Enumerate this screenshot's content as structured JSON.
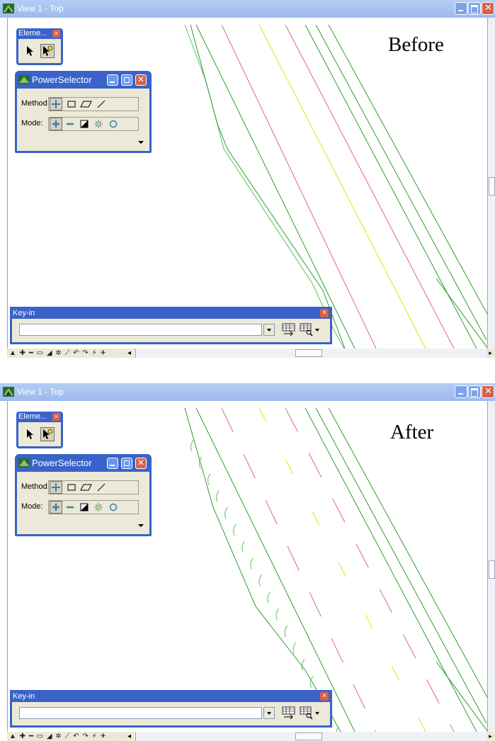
{
  "panels": [
    {
      "annotation": "Before",
      "window": {
        "title": "View 1 - Top"
      },
      "element_toolbox": {
        "title": "Eleme..."
      },
      "power_selector": {
        "title": "PowerSelector",
        "method_label": "Method:",
        "mode_label": "Mode:"
      },
      "keyin": {
        "title": "Key-in",
        "value": ""
      },
      "road_lines": {
        "green": "#2e9e2e",
        "light_green": "#55c655",
        "red": "#e06a6a",
        "yellow": "#e6e000",
        "centerline_style": "solid",
        "has_edge_symbols": false
      }
    },
    {
      "annotation": "After",
      "window": {
        "title": "View 1 - Top"
      },
      "element_toolbox": {
        "title": "Eleme..."
      },
      "power_selector": {
        "title": "PowerSelector",
        "method_label": "Method:",
        "mode_label": "Mode:"
      },
      "keyin": {
        "title": "Key-in",
        "value": ""
      },
      "road_lines": {
        "green": "#2e9e2e",
        "light_green": "#55c655",
        "red": "#e06a6a",
        "yellow": "#e6e000",
        "centerline_style": "dashed",
        "has_edge_symbols": true
      }
    }
  ],
  "icons": {
    "app_logo": "bentley-logo-icon",
    "pointer": "arrow-pointer-icon",
    "power_select": "power-selector-icon",
    "method_individual": "individual-method-icon",
    "method_block": "block-method-icon",
    "method_shape": "shape-method-icon",
    "method_line": "line-method-icon",
    "mode_add": "add-mode-icon",
    "mode_subtract": "subtract-mode-icon",
    "mode_invert": "invert-mode-icon",
    "mode_new": "new-mode-icon",
    "mode_clear": "clear-mode-icon"
  }
}
